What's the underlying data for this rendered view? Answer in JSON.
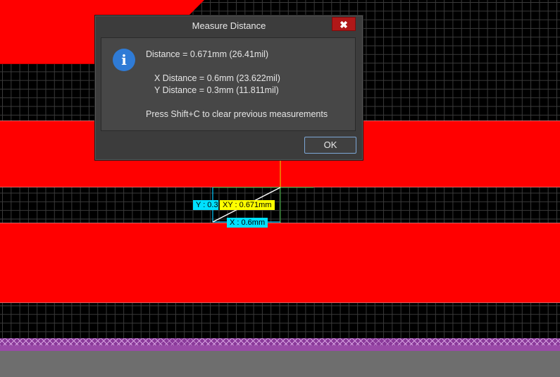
{
  "dialog": {
    "title": "Measure Distance",
    "close_glyph": "✖",
    "icon": "info-icon",
    "info_glyph": "i",
    "distance_line": "Distance = 0.671mm (26.41mil)",
    "x_distance_line": "X Distance = 0.6mm (23.622mil)",
    "y_distance_line": "Y Distance = 0.3mm (11.811mil)",
    "hint": "Press Shift+C to clear previous measurements",
    "ok_label": "OK"
  },
  "measurement": {
    "y_label": "Y : 0.3mm",
    "xy_label": "XY : 0.671mm",
    "x_label": "X : 0.6mm"
  },
  "colors": {
    "copper": "#ff0000",
    "grid": "#3a3a3a",
    "label_cyan": "#00e0ff",
    "label_yellow": "#ffff00",
    "close_button": "#b01818",
    "info_icon": "#2f7bd6"
  }
}
